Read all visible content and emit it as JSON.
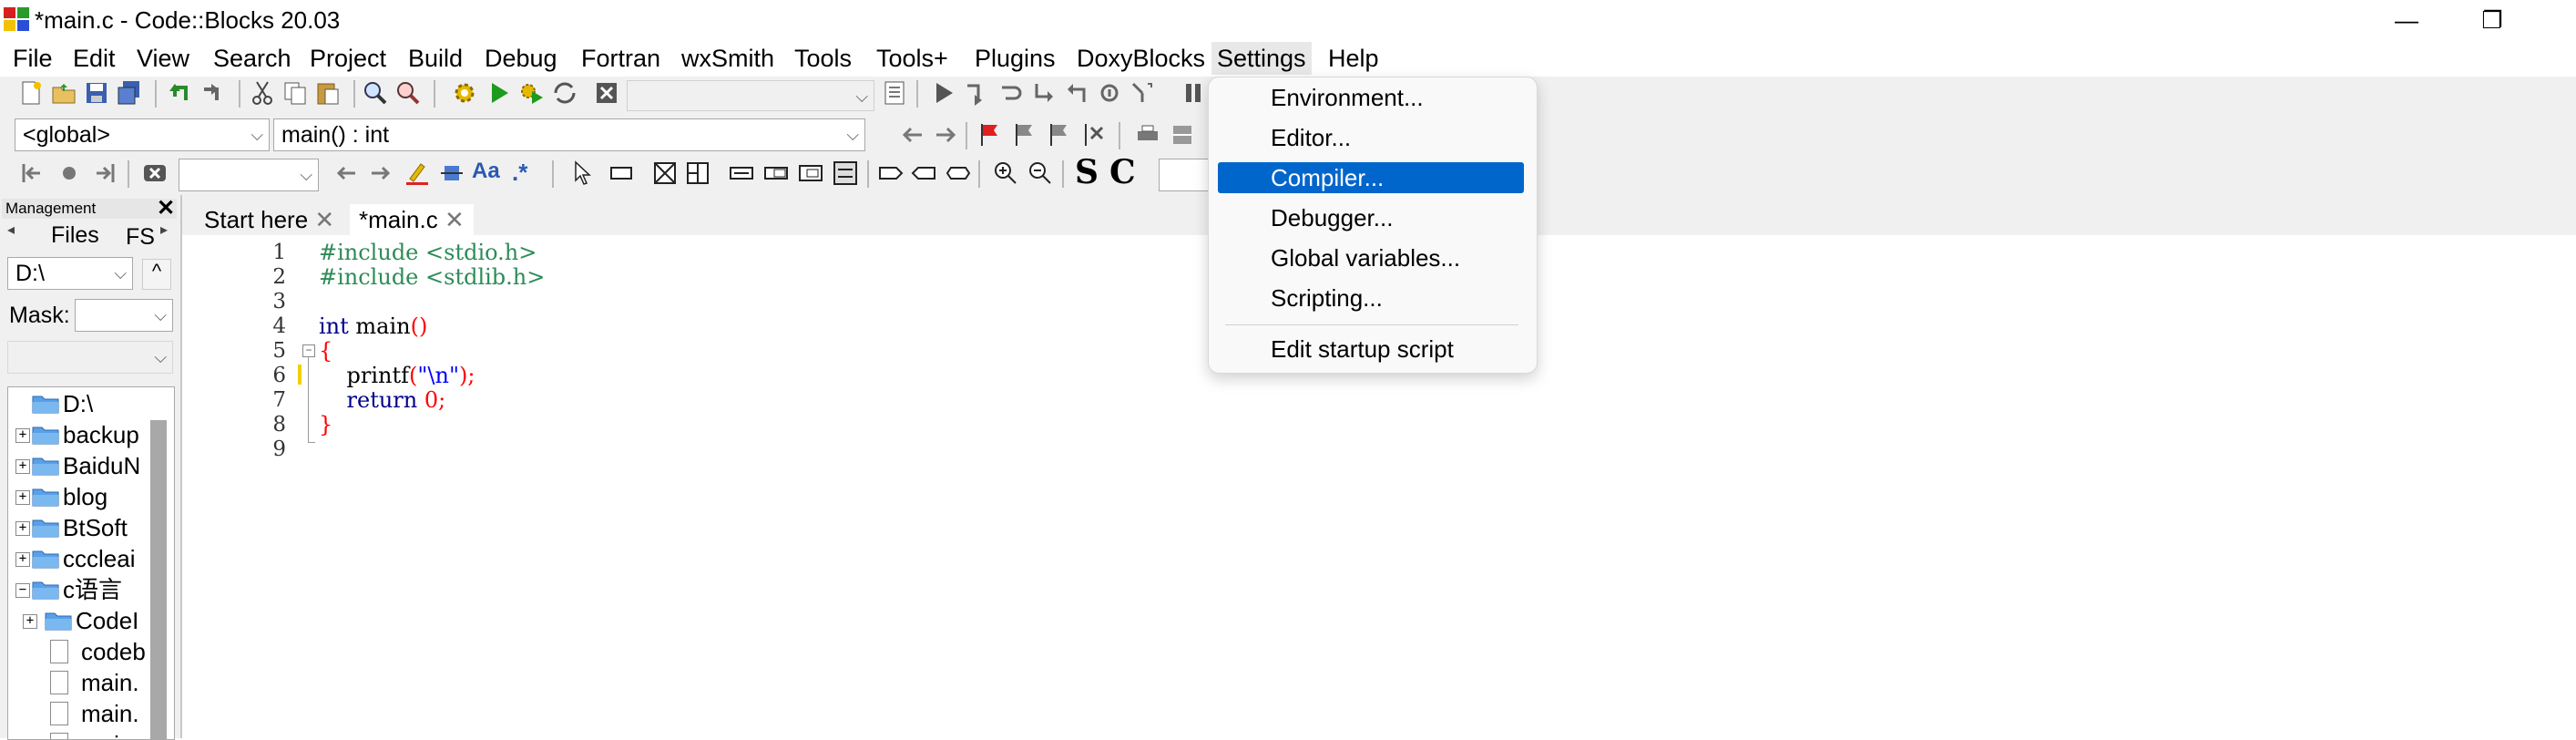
{
  "window": {
    "title": "*main.c - Code::Blocks 20.03",
    "minimize_glyph": "—",
    "maximize_glyph": "❐",
    "close_glyph": "✕"
  },
  "menu": [
    "File",
    "Edit",
    "View",
    "Search",
    "Project",
    "Build",
    "Debug",
    "Fortran",
    "wxSmith",
    "Tools",
    "Tools+",
    "Plugins",
    "DoxyBlocks",
    "Settings",
    "Help"
  ],
  "toolbar": {
    "scope_combo": "<global>",
    "function_combo": "main() : int",
    "regex_label": ".*",
    "bold_s": "S",
    "bold_c": "C"
  },
  "settings_menu": {
    "items": [
      "Environment...",
      "Editor...",
      "Compiler...",
      "Debugger...",
      "Global variables...",
      "Scripting..."
    ],
    "selected": "Compiler...",
    "startup": "Edit startup script"
  },
  "management": {
    "title": "Management",
    "tabs": [
      "Files",
      "FS"
    ],
    "path": "D:\\",
    "up_button": "^",
    "mask_label": "Mask:",
    "tree": [
      {
        "label": "D:\\",
        "type": "folder",
        "expander": ""
      },
      {
        "label": "backup",
        "type": "folder",
        "expander": "+"
      },
      {
        "label": "BaiduN",
        "type": "folder",
        "expander": "+"
      },
      {
        "label": "blog",
        "type": "folder",
        "expander": "+"
      },
      {
        "label": "BtSoft",
        "type": "folder",
        "expander": "+"
      },
      {
        "label": "cccleai",
        "type": "folder",
        "expander": "+"
      },
      {
        "label": "c语言",
        "type": "folder",
        "expander": "−"
      },
      {
        "label": "CodeI",
        "type": "folder",
        "expander": "+"
      },
      {
        "label": "codeb",
        "type": "file",
        "expander": ""
      },
      {
        "label": "main.",
        "type": "file",
        "expander": ""
      },
      {
        "label": "main.",
        "type": "file",
        "expander": ""
      },
      {
        "label": "main.",
        "type": "file",
        "expander": ""
      }
    ]
  },
  "editor": {
    "tabs": [
      {
        "label": "Start here",
        "close": "✕"
      },
      {
        "label": "*main.c",
        "close": "✕"
      }
    ],
    "line_numbers": [
      "1",
      "2",
      "3",
      "4",
      "5",
      "6",
      "7",
      "8",
      "9"
    ],
    "code": {
      "l1_a": "#include",
      "l1_b": " <stdio.h>",
      "l2_a": "#include",
      "l2_b": " <stdlib.h>",
      "l4_a": "int",
      "l4_b": " main",
      "l4_c": "()",
      "l5_a": "{",
      "l6_a": "    printf",
      "l6_b": "(",
      "l6_c": "\"\\n\"",
      "l6_d": ");",
      "l7_a": "    return",
      "l7_b": " 0",
      "l7_c": ";",
      "l8_a": "}"
    }
  },
  "colors": {
    "accent": "#0066cc",
    "keyword": "#00008b",
    "preprocessor": "#2e8b57",
    "string": "#0000ff",
    "operator": "#ff0000"
  }
}
